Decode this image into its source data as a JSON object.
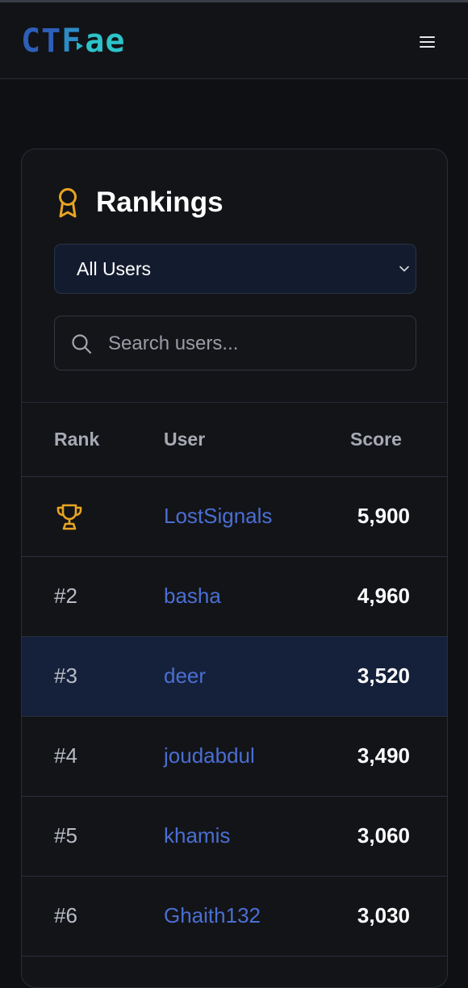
{
  "header": {
    "logo": {
      "part1": "CT",
      "part2": "F",
      "part3": "ae"
    },
    "menu_icon": "hamburger-menu-icon"
  },
  "rankings": {
    "title": "Rankings",
    "title_icon": "award-ribbon-icon",
    "filter": {
      "selected": "All Users",
      "icon": "chevron-down-icon"
    },
    "search": {
      "placeholder": "Search users...",
      "value": "",
      "icon": "search-icon"
    },
    "columns": {
      "rank": "Rank",
      "user": "User",
      "score": "Score"
    },
    "rows": [
      {
        "rank": "",
        "rank_icon": "trophy-icon",
        "user": "LostSignals",
        "score": "5,900"
      },
      {
        "rank": "#2",
        "user": "basha",
        "score": "4,960"
      },
      {
        "rank": "#3",
        "user": "deer",
        "score": "3,520",
        "highlighted": true
      },
      {
        "rank": "#4",
        "user": "joudabdul",
        "score": "3,490"
      },
      {
        "rank": "#5",
        "user": "khamis",
        "score": "3,060"
      },
      {
        "rank": "#6",
        "user": "Ghaith132",
        "score": "3,030"
      }
    ]
  },
  "colors": {
    "background": "#0f1014",
    "card": "#131418",
    "accent_gold": "#e8a521",
    "user_link": "#4a6fd2",
    "highlight_row": "#15203a"
  }
}
